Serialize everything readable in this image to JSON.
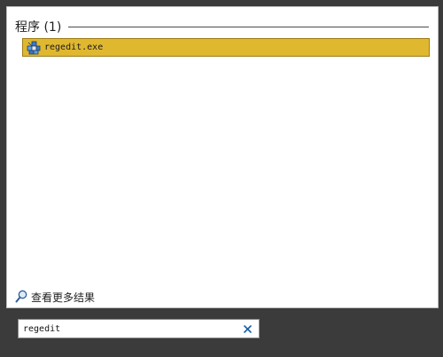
{
  "results": {
    "section_title": "程序 (1)",
    "items": [
      {
        "label": "regedit.exe",
        "icon": "registry-editor-icon",
        "selected": true
      }
    ],
    "see_more_label": "查看更多结果",
    "see_more_icon": "magnifier-icon"
  },
  "search": {
    "value": "regedit",
    "clear_icon": "clear-x-icon"
  },
  "colors": {
    "selection": "#e0b830",
    "selection_border": "#9e7c16",
    "taskbar": "#3b3b3b",
    "clear_icon": "#1a5fa8"
  }
}
